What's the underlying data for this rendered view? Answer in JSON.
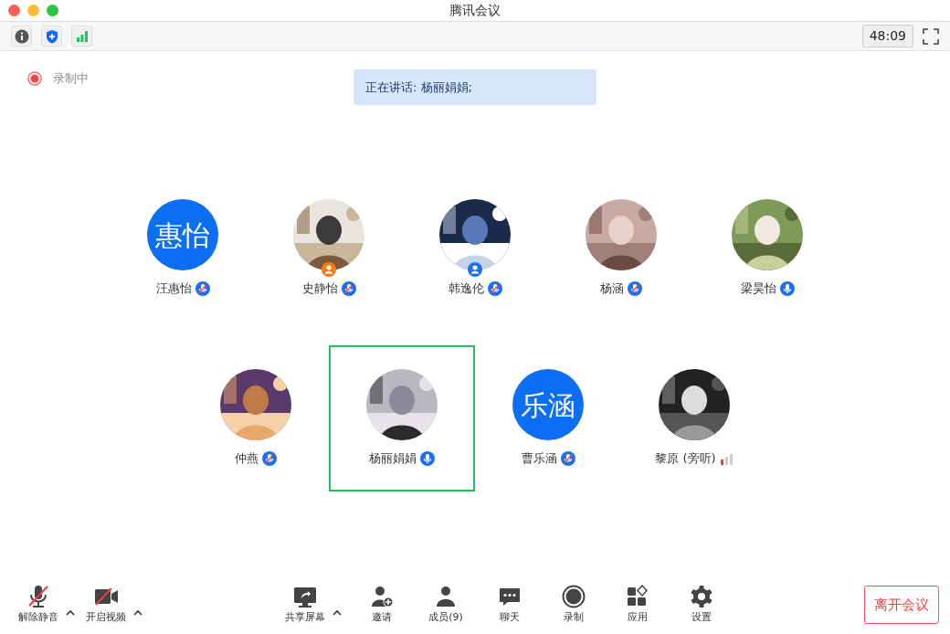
{
  "window": {
    "title": "腾讯会议"
  },
  "toolbar": {
    "timer": "48:09"
  },
  "recording": {
    "label": "录制中"
  },
  "speaking_banner": "正在讲话: 杨丽娟娟;",
  "participant_rows": [
    [
      {
        "name": "汪惠怡",
        "initials": "惠怡",
        "kind": "muted",
        "selected": false
      },
      {
        "name": "史静怡",
        "kind": "muted",
        "color": "#f57c14",
        "selected": false
      },
      {
        "name": "韩逸伦",
        "kind": "muted",
        "color": "#1e6ff0",
        "selected": false
      },
      {
        "name": "杨涵",
        "kind": "muted",
        "selected": false
      },
      {
        "name": "梁昊怡",
        "kind": "unmuted",
        "selected": false
      }
    ],
    [
      {
        "name": "仲燕",
        "kind": "muted",
        "selected": false
      },
      {
        "name": "杨丽娟娟",
        "kind": "unmuted",
        "selected": true
      },
      {
        "name": "曹乐涵",
        "initials": "乐涵",
        "kind": "muted",
        "selected": false
      },
      {
        "name": "黎原 (旁听)",
        "kind": "audience",
        "selected": false
      }
    ]
  ],
  "controls": [
    {
      "label": "解除静音",
      "caret": true
    },
    {
      "label": "开启视频",
      "caret": true
    },
    {
      "label": "共享屏幕",
      "caret": true
    },
    {
      "label": "邀请",
      "caret": false
    },
    {
      "label": "成员(9)",
      "caret": false
    },
    {
      "label": "聊天",
      "caret": false
    },
    {
      "label": "录制",
      "caret": false
    },
    {
      "label": "应用",
      "caret": false
    },
    {
      "label": "设置",
      "caret": false
    }
  ],
  "leave_button": "离开会议"
}
